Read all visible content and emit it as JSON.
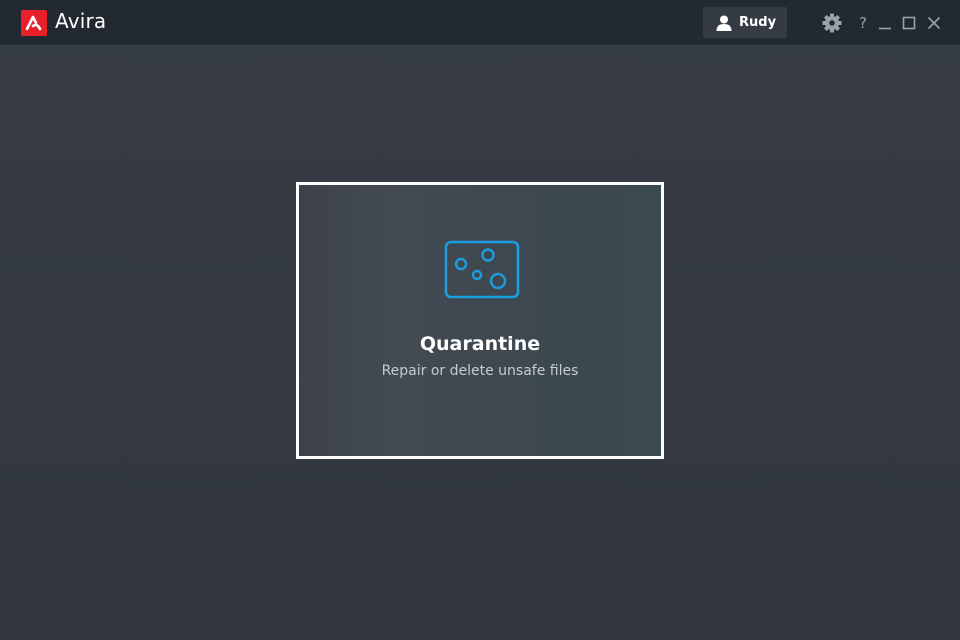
{
  "app": {
    "title": "Avira",
    "brand_color": "#e8202a"
  },
  "titlebar": {
    "user": {
      "name": "Rudy",
      "icon": "user-icon"
    },
    "controls": {
      "settings_icon": "gear-icon",
      "help_label": "?",
      "minimize_icon": "minimize-icon",
      "maximize_icon": "maximize-icon",
      "close_icon": "close-icon"
    }
  },
  "card": {
    "title": "Quarantine",
    "subtitle": "Repair or delete unsafe files",
    "icon": "quarantine-icon",
    "accent_color": "#1a9ee0"
  }
}
